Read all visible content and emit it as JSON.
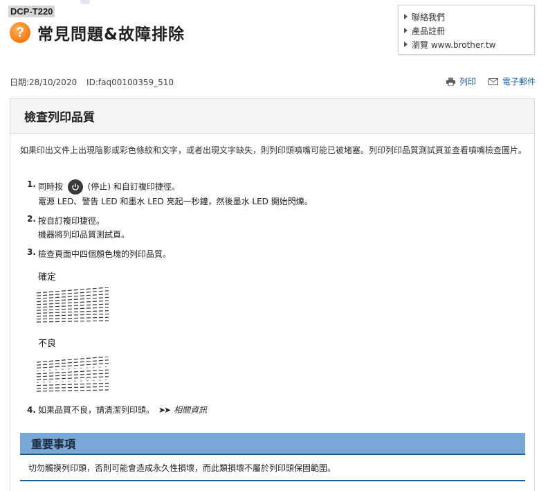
{
  "header": {
    "model": "DCP-T220",
    "title": "常見問題&故障排除",
    "question_icon": "?"
  },
  "side_links": [
    {
      "label": "聯絡我們",
      "icon": "triangle-right-icon"
    },
    {
      "label": "產品註冊",
      "icon": "triangle-right-icon"
    },
    {
      "label": "瀏覽 www.brother.tw",
      "icon": "triangle-right-icon"
    }
  ],
  "meta": {
    "date": "日期:28/10/2020",
    "id": "ID:faq00100359_510"
  },
  "actions": {
    "print": "列印",
    "email": "電子郵件"
  },
  "panel": {
    "title": "檢查列印品質",
    "intro": "如果印出文件上出現陰影或彩色條紋和文字，或者出現文字缺失，則列印頭噴嘴可能已被堵塞。列印列印品質測試頁並查看噴嘴檢查圖片。",
    "steps": [
      {
        "num": "1.",
        "pre": "同時按",
        "post": "(停止) 和自訂複印捷徑。",
        "sub": "電源 LED、警告 LED 和墨水 LED 亮起一秒鐘，然後墨水 LED 開始閃爍。"
      },
      {
        "num": "2.",
        "text": "按自訂複印捷徑。",
        "sub": "機器將列印品質測試頁。"
      },
      {
        "num": "3.",
        "text": "檢查頁面中四個顏色塊的列印品質。"
      }
    ],
    "good_label": "確定",
    "bad_label": "不良",
    "step4": {
      "num": "4.",
      "text": "如果品質不良，請清潔列印頭。",
      "arrows": "➤➤",
      "related": "相關資訊"
    }
  },
  "important": {
    "title": "重要事項",
    "text": "切勿觸摸列印頭，否則可能會造成永久性損壞，而此類損壞不屬於列印頭保固範圍。"
  },
  "colors": {
    "accent_blue": "#7aa8d6",
    "border_blue": "#1f5c96",
    "link_blue": "#1a5a99",
    "question_orange": "#f07a14"
  }
}
